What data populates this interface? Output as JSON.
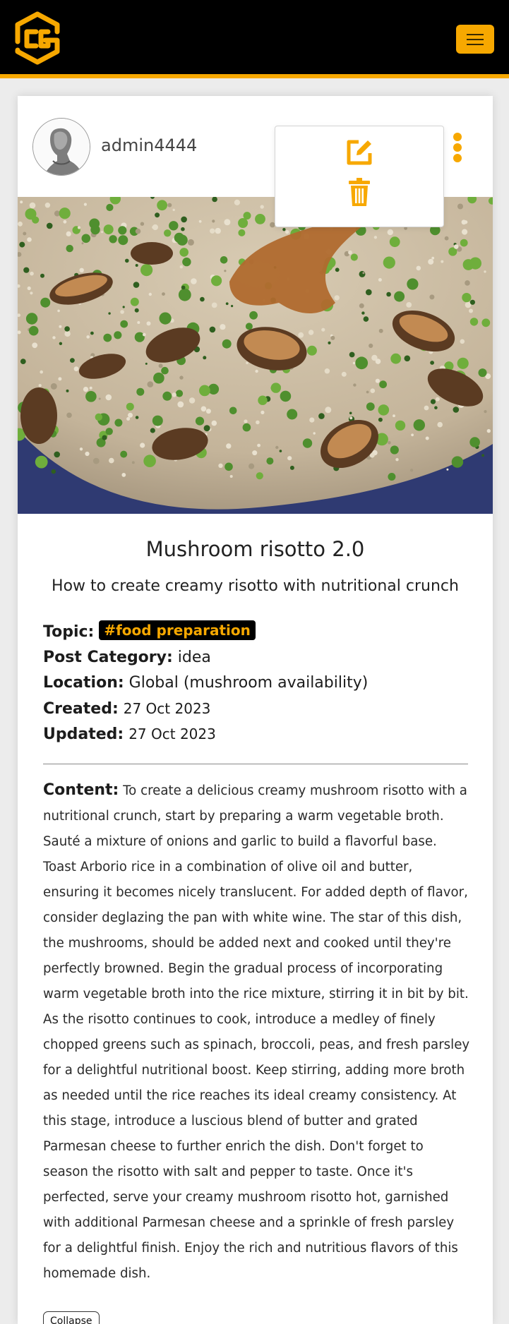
{
  "navbar": {
    "logo_icon": "cube-logo-icon",
    "menu_icon": "hamburger-icon",
    "accent_color": "#f7a800"
  },
  "post": {
    "author": "admin4444",
    "menu": {
      "icon": "vertical-ellipsis-icon",
      "items": [
        {
          "icon": "edit-icon"
        },
        {
          "icon": "trash-icon"
        }
      ]
    },
    "title": "Mushroom risotto 2.0",
    "subtitle": "How to create creamy risotto with nutritional crunch",
    "meta": {
      "topic_label": "Topic:",
      "topic_value": "#food preparation",
      "category_label": "Post Category:",
      "category_value": "idea",
      "location_label": "Location:",
      "location_value": "Global (mushroom availability)",
      "created_label": "Created:",
      "created_value": "27 Oct 2023",
      "updated_label": "Updated:",
      "updated_value": "27 Oct 2023"
    },
    "content_label": "Content:",
    "content_text": "To create a delicious creamy mushroom risotto with a nutritional crunch, start by preparing a warm vegetable broth. Sauté a mixture of onions and garlic to build a flavorful base. Toast Arborio rice in a combination of olive oil and butter, ensuring it becomes nicely translucent. For added depth of flavor, consider deglazing the pan with white wine. The star of this dish, the mushrooms, should be added next and cooked until they're perfectly browned. Begin the gradual process of incorporating warm vegetable broth into the rice mixture, stirring it in bit by bit. As the risotto continues to cook, introduce a medley of finely chopped greens such as spinach, broccoli, peas, and fresh parsley for a delightful nutritional boost. Keep stirring, adding more broth as needed until the rice reaches its ideal creamy consistency. At this stage, introduce a luscious blend of butter and grated Parmesan cheese to further enrich the dish. Don't forget to season the risotto with salt and pepper to taste. Once it's perfected, serve your creamy mushroom risotto hot, garnished with additional Parmesan cheese and a sprinkle of fresh parsley for a delightful finish. Enjoy the rich and nutritious flavors of this homemade dish.",
    "collapse_label": "Collapse"
  }
}
